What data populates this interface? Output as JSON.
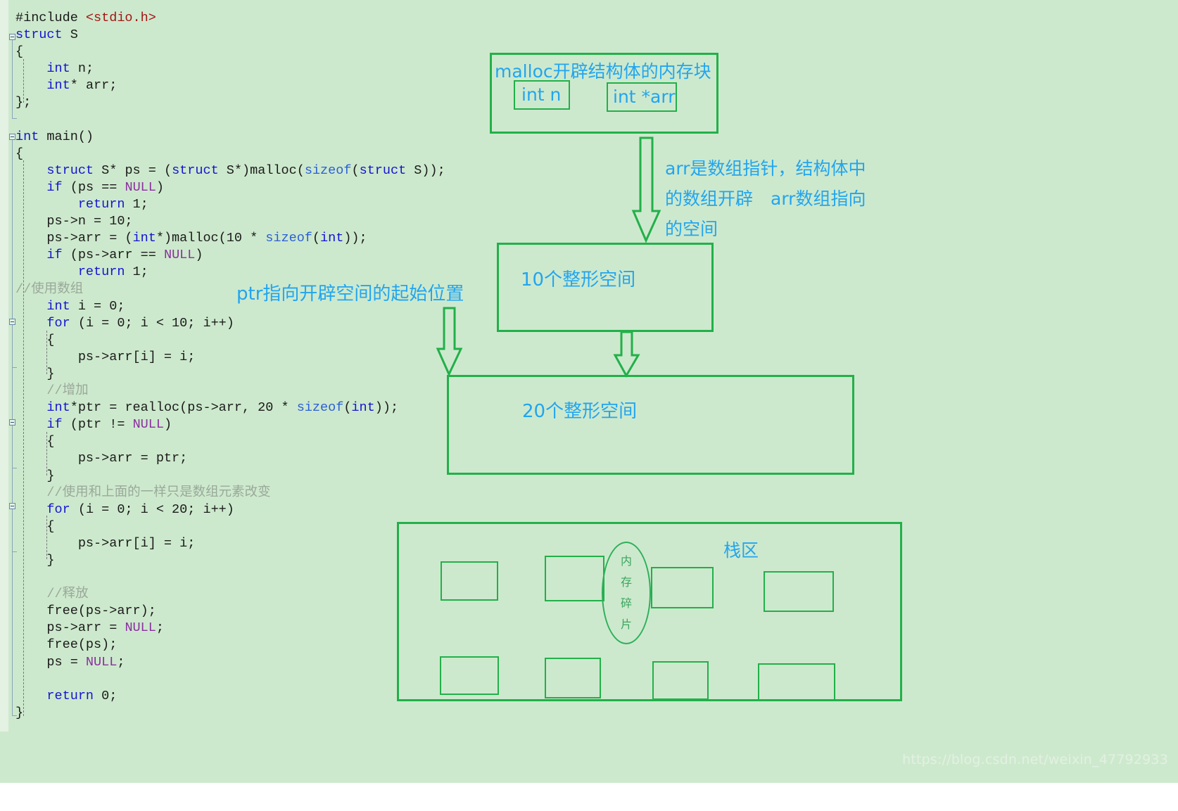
{
  "editor": {
    "code_lines": [
      [
        {
          "t": "#include ",
          "c": "pun"
        },
        {
          "t": "<stdio.h>",
          "c": "inc"
        }
      ],
      [
        {
          "t": "struct",
          "c": "kw"
        },
        {
          "t": " S",
          "c": "pun"
        }
      ],
      [
        {
          "t": "{",
          "c": "pun"
        }
      ],
      [
        {
          "t": "    ",
          "c": "pun"
        },
        {
          "t": "int",
          "c": "kw"
        },
        {
          "t": " n;",
          "c": "pun"
        }
      ],
      [
        {
          "t": "    ",
          "c": "pun"
        },
        {
          "t": "int",
          "c": "kw"
        },
        {
          "t": "* arr;",
          "c": "pun"
        }
      ],
      [
        {
          "t": "};",
          "c": "pun"
        }
      ],
      [
        {
          "t": "",
          "c": "pun"
        }
      ],
      [
        {
          "t": "int",
          "c": "kw"
        },
        {
          "t": " main()",
          "c": "pun"
        }
      ],
      [
        {
          "t": "{",
          "c": "pun"
        }
      ],
      [
        {
          "t": "    ",
          "c": "pun"
        },
        {
          "t": "struct",
          "c": "kw"
        },
        {
          "t": " S* ps = (",
          "c": "pun"
        },
        {
          "t": "struct",
          "c": "kw"
        },
        {
          "t": " S*)malloc(",
          "c": "pun"
        },
        {
          "t": "sizeof",
          "c": "typ"
        },
        {
          "t": "(",
          "c": "pun"
        },
        {
          "t": "struct",
          "c": "kw"
        },
        {
          "t": " S));",
          "c": "pun"
        }
      ],
      [
        {
          "t": "    ",
          "c": "pun"
        },
        {
          "t": "if",
          "c": "kw"
        },
        {
          "t": " (ps == ",
          "c": "pun"
        },
        {
          "t": "NULL",
          "c": "null"
        },
        {
          "t": ")",
          "c": "pun"
        }
      ],
      [
        {
          "t": "        ",
          "c": "pun"
        },
        {
          "t": "return",
          "c": "kw"
        },
        {
          "t": " 1;",
          "c": "pun"
        }
      ],
      [
        {
          "t": "    ps->n = 10;",
          "c": "pun"
        }
      ],
      [
        {
          "t": "    ps->arr = (",
          "c": "pun"
        },
        {
          "t": "int",
          "c": "kw"
        },
        {
          "t": "*)malloc(10 * ",
          "c": "pun"
        },
        {
          "t": "sizeof",
          "c": "typ"
        },
        {
          "t": "(",
          "c": "pun"
        },
        {
          "t": "int",
          "c": "kw"
        },
        {
          "t": "));",
          "c": "pun"
        }
      ],
      [
        {
          "t": "    ",
          "c": "pun"
        },
        {
          "t": "if",
          "c": "kw"
        },
        {
          "t": " (ps->arr == ",
          "c": "pun"
        },
        {
          "t": "NULL",
          "c": "null"
        },
        {
          "t": ")",
          "c": "pun"
        }
      ],
      [
        {
          "t": "        ",
          "c": "pun"
        },
        {
          "t": "return",
          "c": "kw"
        },
        {
          "t": " 1;",
          "c": "pun"
        }
      ],
      [
        {
          "t": "//使用数组",
          "c": "cmt"
        }
      ],
      [
        {
          "t": "    ",
          "c": "pun"
        },
        {
          "t": "int",
          "c": "kw"
        },
        {
          "t": " i = 0;",
          "c": "pun"
        }
      ],
      [
        {
          "t": "    ",
          "c": "pun"
        },
        {
          "t": "for",
          "c": "kw"
        },
        {
          "t": " (i = 0; i < 10; i++)",
          "c": "pun"
        }
      ],
      [
        {
          "t": "    {",
          "c": "pun"
        }
      ],
      [
        {
          "t": "        ps->arr[i] = i;",
          "c": "pun"
        }
      ],
      [
        {
          "t": "    }",
          "c": "pun"
        }
      ],
      [
        {
          "t": "    ",
          "c": "pun"
        },
        {
          "t": "//增加",
          "c": "cmt"
        }
      ],
      [
        {
          "t": "    ",
          "c": "pun"
        },
        {
          "t": "int",
          "c": "kw"
        },
        {
          "t": "*ptr = realloc(ps->arr, 20 * ",
          "c": "pun"
        },
        {
          "t": "sizeof",
          "c": "typ"
        },
        {
          "t": "(",
          "c": "pun"
        },
        {
          "t": "int",
          "c": "kw"
        },
        {
          "t": "));",
          "c": "pun"
        }
      ],
      [
        {
          "t": "    ",
          "c": "pun"
        },
        {
          "t": "if",
          "c": "kw"
        },
        {
          "t": " (ptr != ",
          "c": "pun"
        },
        {
          "t": "NULL",
          "c": "null"
        },
        {
          "t": ")",
          "c": "pun"
        }
      ],
      [
        {
          "t": "    {",
          "c": "pun"
        }
      ],
      [
        {
          "t": "        ps->arr = ptr;",
          "c": "pun"
        }
      ],
      [
        {
          "t": "    }",
          "c": "pun"
        }
      ],
      [
        {
          "t": "    ",
          "c": "pun"
        },
        {
          "t": "//使用和上面的一样只是数组元素改变",
          "c": "cmt"
        }
      ],
      [
        {
          "t": "    ",
          "c": "pun"
        },
        {
          "t": "for",
          "c": "kw"
        },
        {
          "t": " (i = 0; i < 20; i++)",
          "c": "pun"
        }
      ],
      [
        {
          "t": "    {",
          "c": "pun"
        }
      ],
      [
        {
          "t": "        ps->arr[i] = i;",
          "c": "pun"
        }
      ],
      [
        {
          "t": "    }",
          "c": "pun"
        }
      ],
      [
        {
          "t": "",
          "c": "pun"
        }
      ],
      [
        {
          "t": "    ",
          "c": "pun"
        },
        {
          "t": "//释放",
          "c": "cmt"
        }
      ],
      [
        {
          "t": "    free(ps->arr);",
          "c": "pun"
        }
      ],
      [
        {
          "t": "    ps->arr = ",
          "c": "pun"
        },
        {
          "t": "NULL",
          "c": "null"
        },
        {
          "t": ";",
          "c": "pun"
        }
      ],
      [
        {
          "t": "    free(ps);",
          "c": "pun"
        }
      ],
      [
        {
          "t": "    ps = ",
          "c": "pun"
        },
        {
          "t": "NULL",
          "c": "null"
        },
        {
          "t": ";",
          "c": "pun"
        }
      ],
      [
        {
          "t": "",
          "c": "pun"
        }
      ],
      [
        {
          "t": "    ",
          "c": "pun"
        },
        {
          "t": "return",
          "c": "kw"
        },
        {
          "t": " 0;",
          "c": "pun"
        }
      ],
      [
        {
          "t": "}",
          "c": "pun"
        }
      ]
    ]
  },
  "diagram": {
    "struct_box_title": "malloc开辟结构体的内存块",
    "field_n": "int n",
    "field_arr": "int *arr",
    "arr_note_line1": "arr是数组指针，结构体中",
    "arr_note_line2": "的数组开辟　arr数组指向",
    "arr_note_line3": "的空间",
    "ptr_note": "ptr指向开辟空间的起始位置",
    "box10_label": "10个整形空间",
    "box20_label": "20个整形空间",
    "stack_label": "栈区",
    "fragment_chars": [
      "内",
      "存",
      "碎",
      "片"
    ]
  },
  "watermark": "https://blog.csdn.net/weixin_47792933",
  "colors": {
    "background": "#cde9cd",
    "diagram_green": "#22b04a",
    "label_blue": "#22a5ef",
    "fragment_green": "#3aa55e",
    "keyword_blue": "#1414d0",
    "null_purple": "#8b2fa0",
    "comment_gray": "#9aa89a",
    "include_red": "#a31515"
  }
}
